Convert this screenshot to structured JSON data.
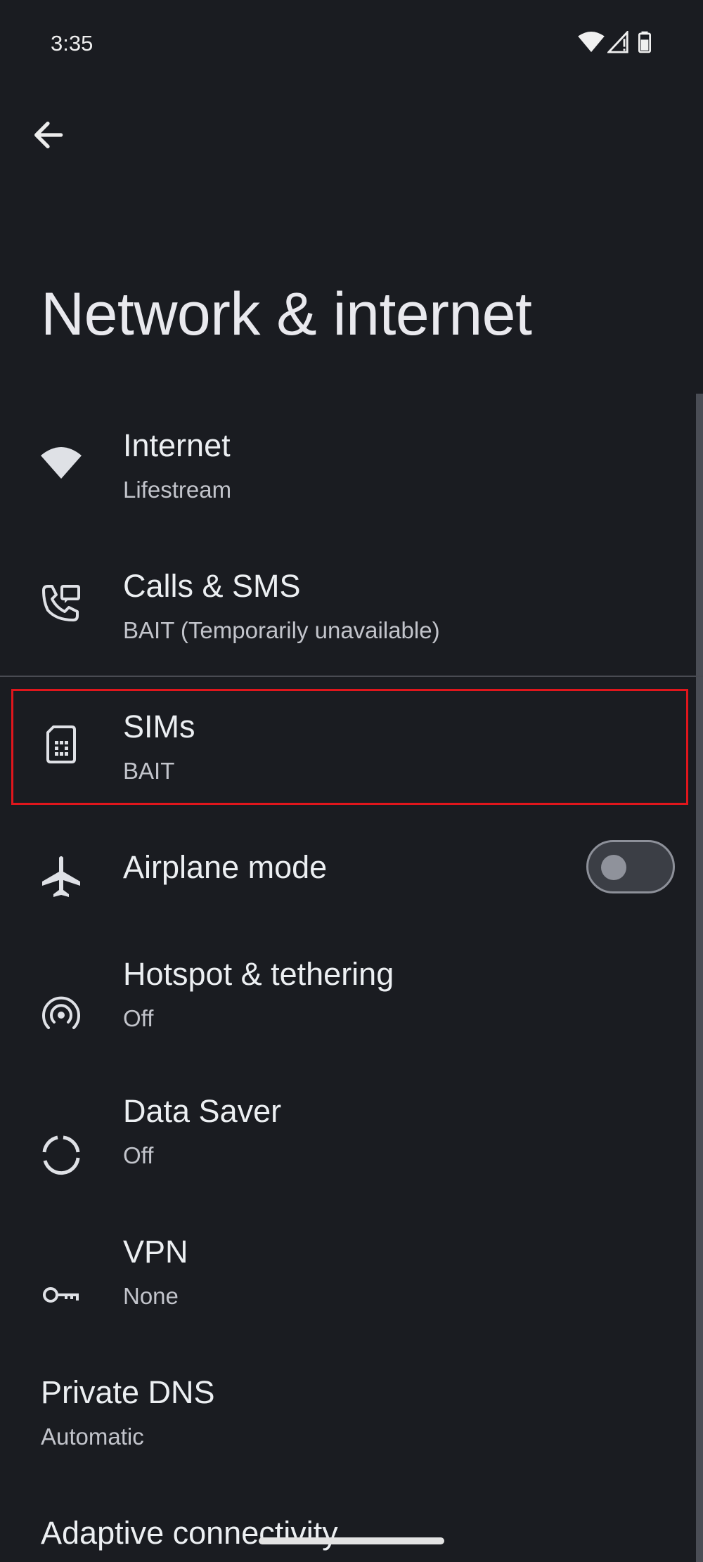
{
  "status_bar": {
    "time": "3:35"
  },
  "page": {
    "title": "Network & internet"
  },
  "items": [
    {
      "title": "Internet",
      "subtitle": "Lifestream",
      "icon": "wifi-icon"
    },
    {
      "title": "Calls & SMS",
      "subtitle": "BAIT (Temporarily unavailable)",
      "icon": "calls-sms-icon"
    },
    {
      "title": "SIMs",
      "subtitle": "BAIT",
      "icon": "sim-card-icon",
      "highlighted": true
    },
    {
      "title": "Airplane mode",
      "icon": "airplane-icon",
      "toggle": false
    },
    {
      "title": "Hotspot & tethering",
      "subtitle": "Off",
      "icon": "hotspot-icon"
    },
    {
      "title": "Data Saver",
      "subtitle": "Off",
      "icon": "data-saver-icon"
    },
    {
      "title": "VPN",
      "subtitle": "None",
      "icon": "vpn-key-icon"
    },
    {
      "title": "Private DNS",
      "subtitle": "Automatic"
    },
    {
      "title": "Adaptive connectivity"
    }
  ],
  "colors": {
    "background": "#1a1c21",
    "highlight_border": "#e0161c",
    "primary_text": "#eceff2",
    "secondary_text": "#c2c4cb"
  }
}
